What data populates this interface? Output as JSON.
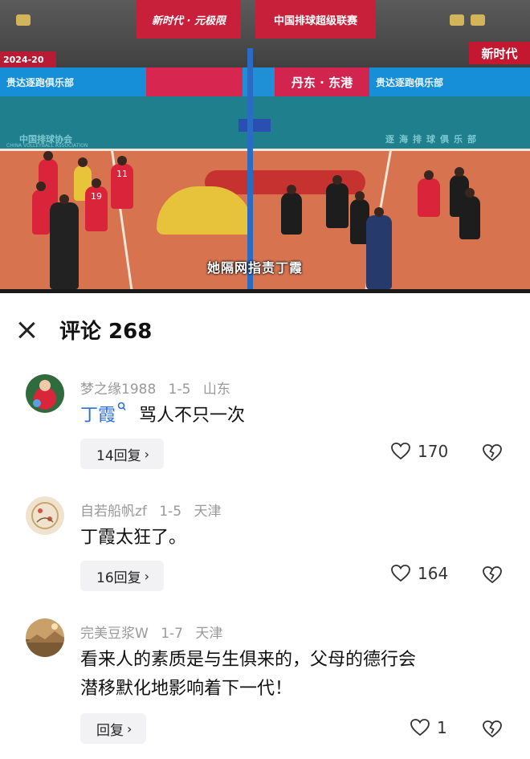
{
  "video": {
    "top_banner": "中国排球超级联赛",
    "top_banner_left": "新时代 · 元极限",
    "season_tag": "2024-20",
    "right_banner": "新时代",
    "ad_left": "贵达逐跑俱乐部",
    "ad_center_right": "丹东 · 东港",
    "ad_right": "贵达逐跑俱乐部",
    "floor_text_left": "中国排球协会",
    "floor_text_left_sub": "CHINA VOLLEYBALL ASSOCIATION",
    "floor_text_right": "逐海排球俱乐部",
    "caption": "她隔网指责丁霞",
    "jersey_numbers": [
      "11",
      "19",
      "19"
    ]
  },
  "comments_panel": {
    "title": "评论 268",
    "comments": [
      {
        "user": "梦之缘1988",
        "date": "1-5",
        "location": "山东",
        "mention": "丁霞",
        "text": "骂人不只一次",
        "replies": "14回复",
        "likes": "170"
      },
      {
        "user": "自若船帆zf",
        "date": "1-5",
        "location": "天津",
        "text": "丁霞太狂了。",
        "replies": "16回复",
        "likes": "164"
      },
      {
        "user": "完美豆浆W",
        "date": "1-7",
        "location": "天津",
        "text_line1": "看来人的素质是与生俱来的，父母的德行会",
        "text_line2": "潜移默化地影响着下一代！",
        "replies": "回复",
        "likes": "1"
      }
    ]
  },
  "colors": {
    "mention": "#2d6fd6",
    "meta": "#999999",
    "reply_bg": "#f2f2f4"
  },
  "icons": [
    "close-icon",
    "search-icon",
    "chevron-right-icon",
    "heart-icon",
    "broken-heart-icon"
  ]
}
